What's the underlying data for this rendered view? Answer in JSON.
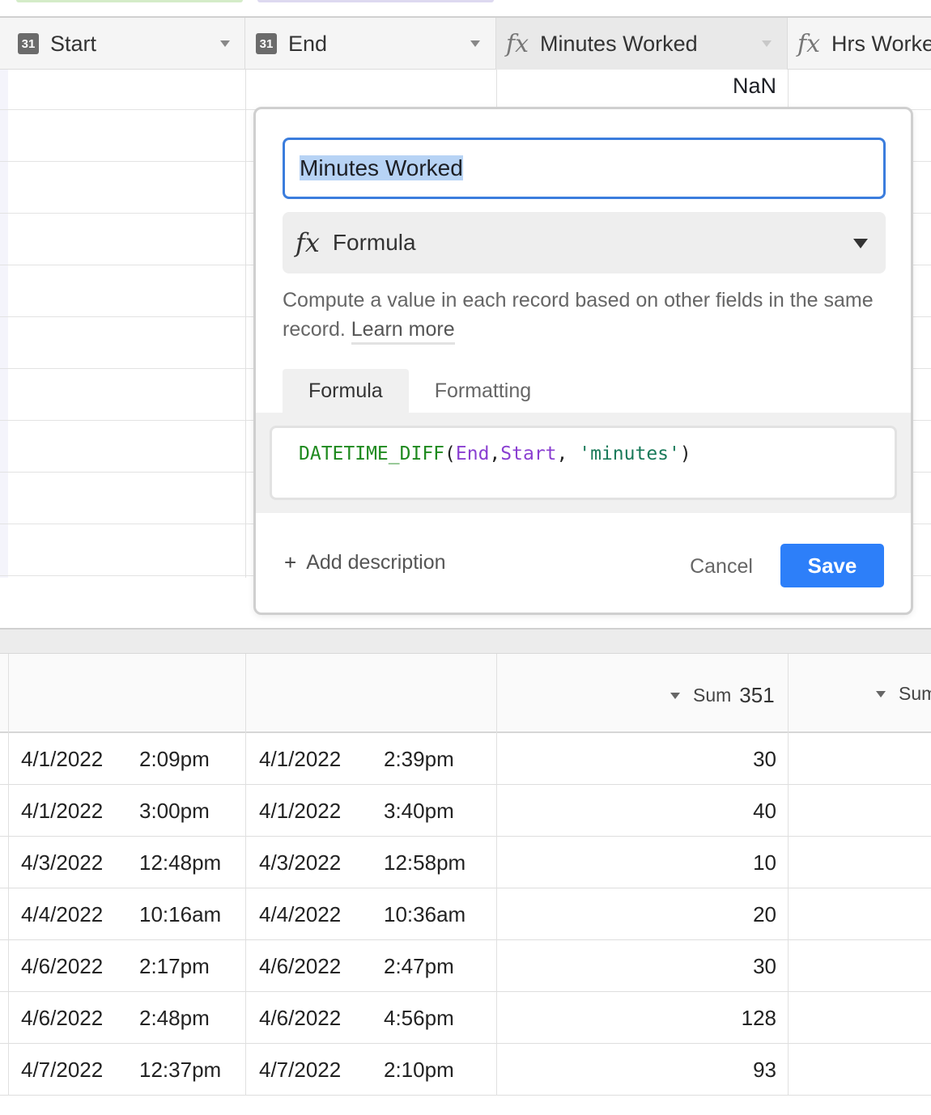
{
  "header": {
    "columns": [
      {
        "label": "Start",
        "icon": "calendar-icon",
        "icon_text": "31"
      },
      {
        "label": "End",
        "icon": "calendar-icon",
        "icon_text": "31"
      },
      {
        "label": "Minutes Worked",
        "icon": "formula-icon"
      },
      {
        "label": "Hrs Worke",
        "icon": "formula-icon"
      }
    ],
    "formula_icon_glyph": "fx"
  },
  "placeholder_row": {
    "minutes": "NaN"
  },
  "field_editor": {
    "name_value": "Minutes Worked",
    "type_label": "Formula",
    "description": "Compute a value in each record based on other fields in the same record.",
    "learn_more": "Learn more",
    "tabs": [
      {
        "label": "Formula",
        "active": true
      },
      {
        "label": "Formatting",
        "active": false
      }
    ],
    "formula": {
      "fn": "DATETIME_DIFF",
      "open": "(",
      "arg1": "End",
      "comma1": ",",
      "arg2": "Start",
      "comma2": ", ",
      "arg3": "'minutes'",
      "close": ")"
    },
    "add_description": "Add description",
    "add_description_prefix": "+",
    "cancel_label": "Cancel",
    "save_label": "Save",
    "colors": {
      "accent": "#2d7ff9",
      "focus_border": "#3b7ddd",
      "selection": "#b7d3f5"
    }
  },
  "summary": {
    "minutes": {
      "label": "Sum",
      "value": "351"
    },
    "hours": {
      "label": "Sum"
    }
  },
  "rows": [
    {
      "start_date": "4/1/2022",
      "start_time": "2:09pm",
      "end_date": "4/1/2022",
      "end_time": "2:39pm",
      "minutes": "30"
    },
    {
      "start_date": "4/1/2022",
      "start_time": "3:00pm",
      "end_date": "4/1/2022",
      "end_time": "3:40pm",
      "minutes": "40"
    },
    {
      "start_date": "4/3/2022",
      "start_time": "12:48pm",
      "end_date": "4/3/2022",
      "end_time": "12:58pm",
      "minutes": "10"
    },
    {
      "start_date": "4/4/2022",
      "start_time": "10:16am",
      "end_date": "4/4/2022",
      "end_time": "10:36am",
      "minutes": "20"
    },
    {
      "start_date": "4/6/2022",
      "start_time": "2:17pm",
      "end_date": "4/6/2022",
      "end_time": "2:47pm",
      "minutes": "30"
    },
    {
      "start_date": "4/6/2022",
      "start_time": "2:48pm",
      "end_date": "4/6/2022",
      "end_time": "4:56pm",
      "minutes": "128"
    },
    {
      "start_date": "4/7/2022",
      "start_time": "12:37pm",
      "end_date": "4/7/2022",
      "end_time": "2:10pm",
      "minutes": "93"
    }
  ]
}
